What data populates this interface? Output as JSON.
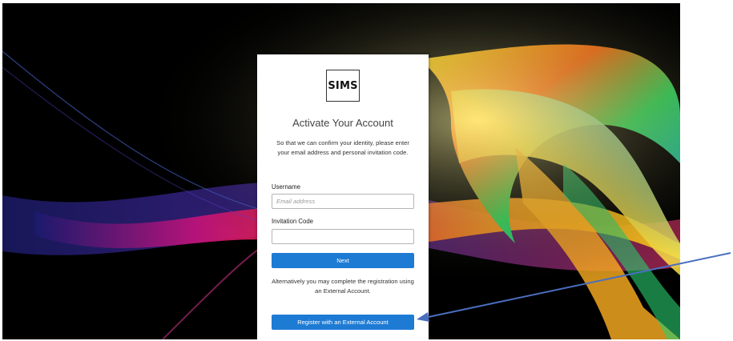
{
  "logo": {
    "text": "SIMS"
  },
  "form": {
    "title": "Activate Your Account",
    "description": "So that we can confirm your identity, please enter your email address and personal invitation code.",
    "username_label": "Username",
    "username_placeholder": "Email address",
    "username_value": "",
    "invitation_label": "Invitation Code",
    "invitation_value": "",
    "next_button": "Next",
    "alternative_text": "Alternatively you may complete the registration using an External Account.",
    "external_button": "Register with an External Account"
  },
  "colors": {
    "primary_button": "#1e7bd4",
    "annotation_arrow": "#4a6fc0",
    "background": "#000000"
  }
}
